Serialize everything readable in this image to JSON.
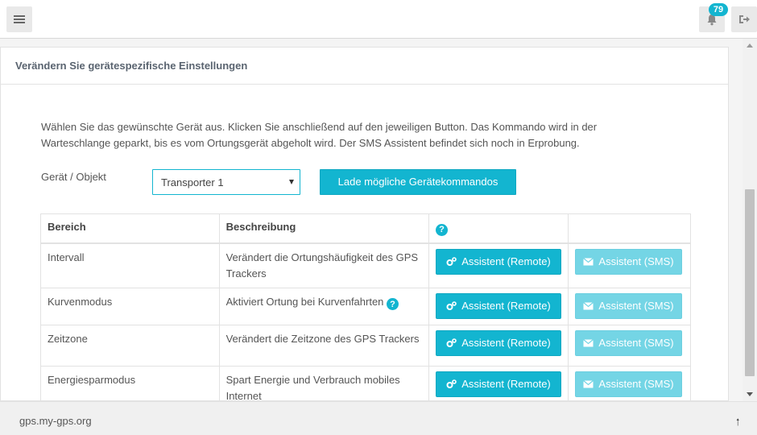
{
  "header": {
    "notification_count": "79",
    "icons": [
      "menu-icon",
      "bell-icon",
      "sign-out-icon"
    ],
    "accent": "#13b5d0"
  },
  "panel": {
    "title": "Verändern Sie gerätespezifische Einstellungen",
    "intro": "Wählen Sie das gewünschte Gerät aus. Klicken Sie anschließend auf den jeweiligen Button. Das Kommando wird in der Warteschlange geparkt, bis es vom Ortungsgerät abgeholt wird. Der SMS Assistent befindet sich noch in Erprobung.",
    "device_label": "Gerät / Objekt",
    "device_selected": "Transporter 1",
    "load_button": "Lade mögliche Gerätekommandos"
  },
  "table": {
    "headers": [
      "Bereich",
      "Beschreibung"
    ],
    "help_icon": "?",
    "rows": [
      {
        "area": "Intervall",
        "description": "Verändert die Ortungshäufigkeit des GPS Trackers",
        "remote": "Assistent (Remote)",
        "sms": "Assistent (SMS)"
      },
      {
        "area": "Kurvenmodus",
        "description": "Aktiviert Ortung bei Kurvenfahrten",
        "remote": "Assistent (Remote)",
        "sms": "Assistent (SMS)"
      },
      {
        "area": "Zeitzone",
        "description": "Verändert die Zeitzone des GPS Trackers",
        "remote": "Assistent (Remote)",
        "sms": "Assistent (SMS)"
      },
      {
        "area": "Energiesparmodus",
        "description": "Spart Energie und Verbrauch mobiles Internet",
        "remote": "Assistent (Remote)",
        "sms": "Assistent (SMS)"
      }
    ]
  },
  "footer": {
    "site": "gps.my-gps.org"
  }
}
